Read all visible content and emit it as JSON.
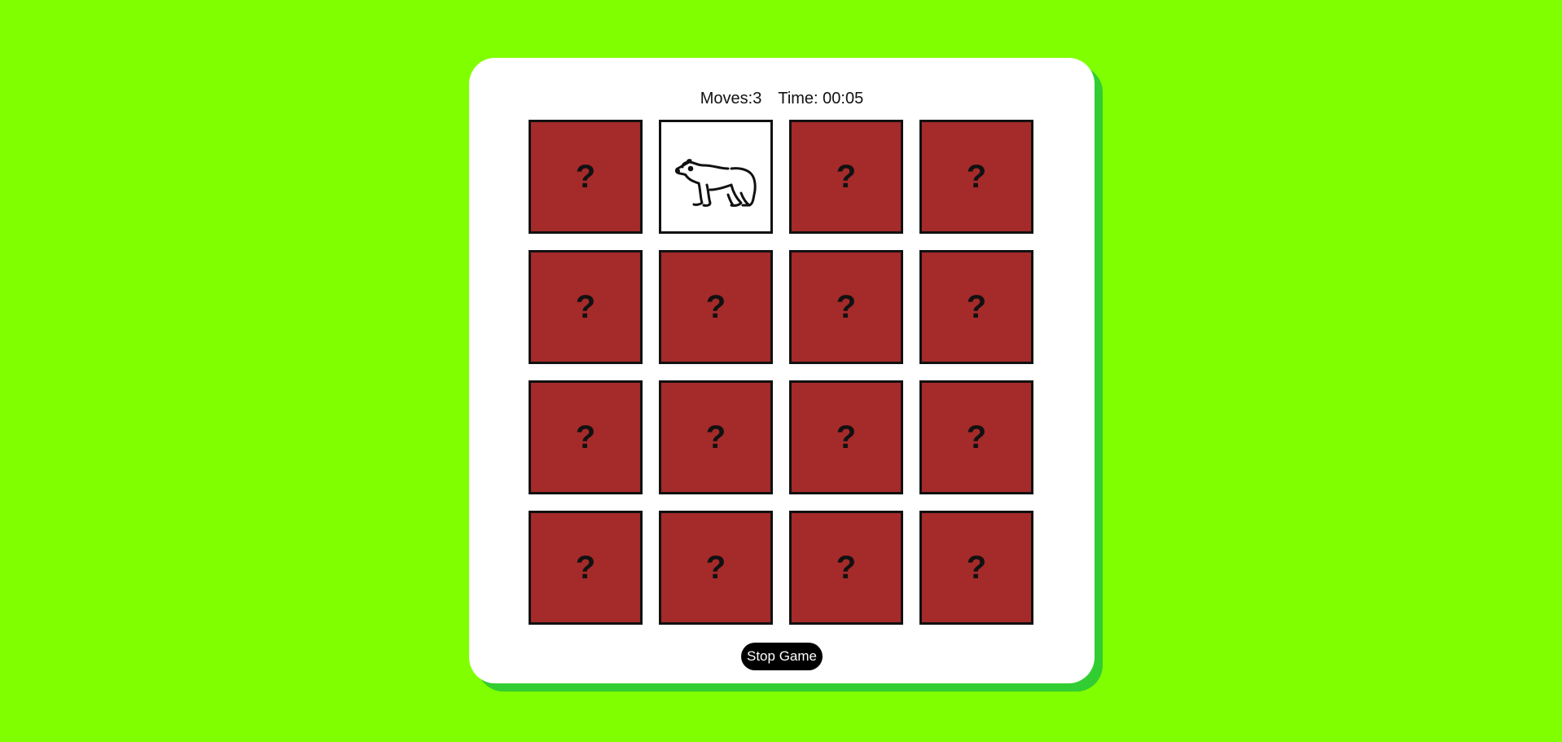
{
  "stats": {
    "moves_label": "Moves:",
    "moves_value": "3",
    "time_label": "Time:",
    "time_value": "00:05"
  },
  "cards": [
    {
      "state": "hidden",
      "face": "?"
    },
    {
      "state": "flipped",
      "face": "polar-bear-icon"
    },
    {
      "state": "hidden",
      "face": "?"
    },
    {
      "state": "hidden",
      "face": "?"
    },
    {
      "state": "hidden",
      "face": "?"
    },
    {
      "state": "hidden",
      "face": "?"
    },
    {
      "state": "hidden",
      "face": "?"
    },
    {
      "state": "hidden",
      "face": "?"
    },
    {
      "state": "hidden",
      "face": "?"
    },
    {
      "state": "hidden",
      "face": "?"
    },
    {
      "state": "hidden",
      "face": "?"
    },
    {
      "state": "hidden",
      "face": "?"
    },
    {
      "state": "hidden",
      "face": "?"
    },
    {
      "state": "hidden",
      "face": "?"
    },
    {
      "state": "hidden",
      "face": "?"
    },
    {
      "state": "hidden",
      "face": "?"
    }
  ],
  "controls": {
    "stop_label": "Stop Game"
  },
  "colors": {
    "background": "#80ff00",
    "panel": "#ffffff",
    "panel_shadow": "#32cd32",
    "card_back": "#a52a2a",
    "card_border": "#111111"
  }
}
